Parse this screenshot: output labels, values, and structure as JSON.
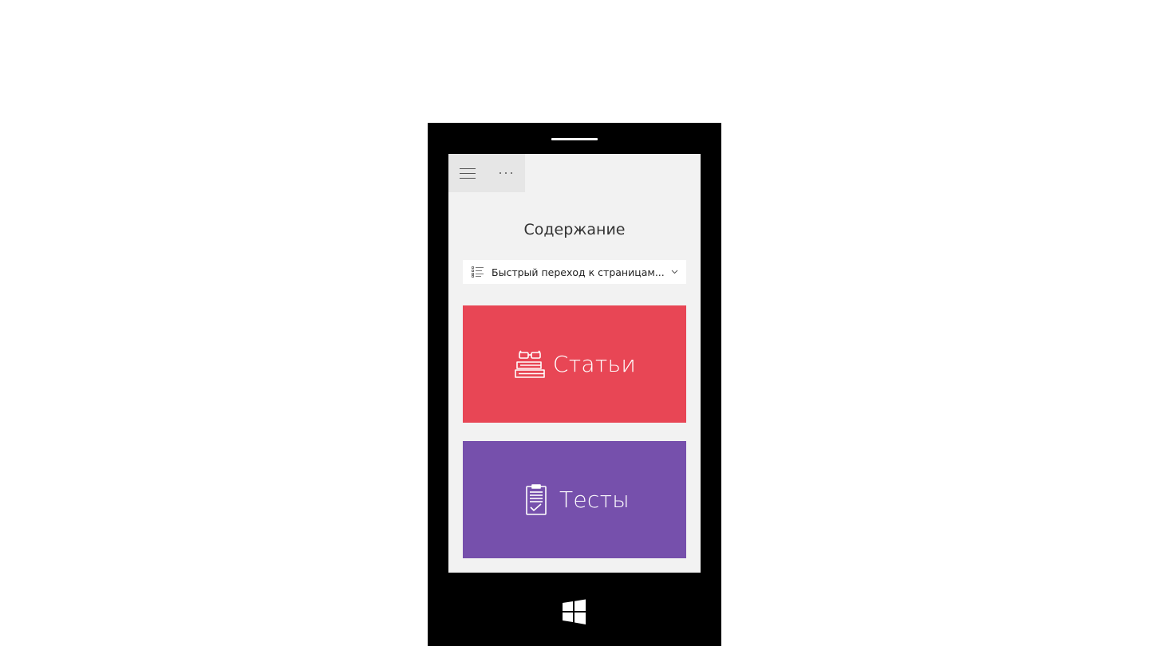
{
  "app": {
    "topbar": {
      "menu_icon": "hamburger-icon",
      "more_icon": "more-dots-icon"
    },
    "page_title": "Содержание",
    "quick_nav": {
      "icon": "list-icon",
      "placeholder": "Быстрый переход к страницам...",
      "chevron": "chevron-down-icon"
    },
    "tiles": [
      {
        "label": "Статьи",
        "icon": "reading-books-icon",
        "color": "#e84655"
      },
      {
        "label": "Тесты",
        "icon": "clipboard-check-icon",
        "color": "#7650ac"
      }
    ]
  },
  "device": {
    "start_icon": "windows-logo-icon",
    "colors": {
      "frame": "#000000",
      "screen_bg": "#f2f2f2",
      "topbar_btn": "#e6e6e6"
    }
  }
}
